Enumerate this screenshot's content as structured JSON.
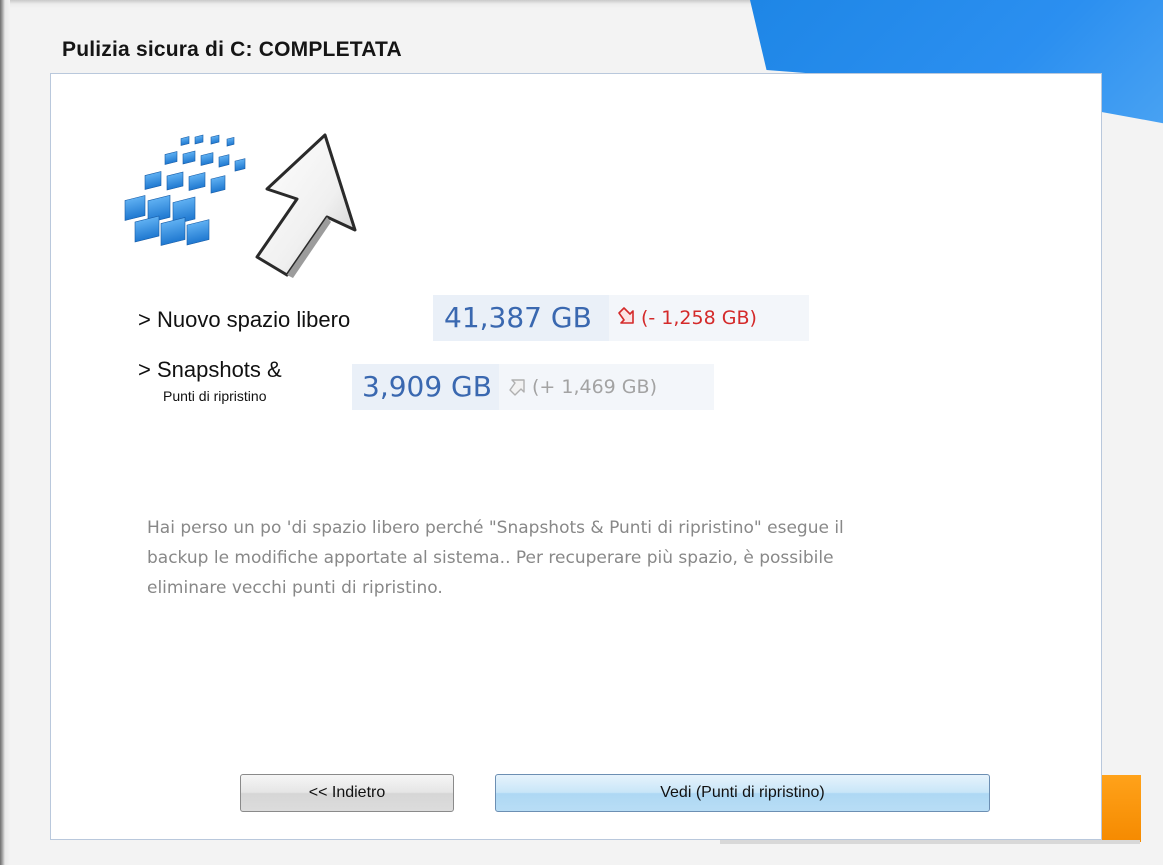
{
  "window": {
    "title": "Pulizia sicura di C: COMPLETATA",
    "colors": {
      "accent_blue": "#2b8ff0",
      "accent_orange": "#f58a00",
      "value_blue": "#3a68b0",
      "delta_red": "#d42a2a"
    }
  },
  "hero": {
    "icon": "cleanup-cursor-icon"
  },
  "stats": {
    "free_space": {
      "label": "> Nuovo spazio libero",
      "value": "41,387 GB",
      "delta": "(- 1,258 GB)",
      "delta_icon": "arrow-down-right-icon"
    },
    "snapshots": {
      "label": "> Snapshots &",
      "sublabel": "Punti di ripristino",
      "value": "3,909 GB",
      "delta": "(+ 1,469 GB)",
      "delta_icon": "arrow-up-right-icon"
    }
  },
  "info": {
    "text": "Hai perso un po 'di spazio libero perché \"Snapshots & Punti di ripristino\" esegue il backup le modifiche apportate al sistema.. Per recuperare più spazio, è possibile eliminare vecchi punti di ripristino."
  },
  "buttons": {
    "back_label": "<< Indietro",
    "view_label": "Vedi (Punti di ripristino)"
  }
}
